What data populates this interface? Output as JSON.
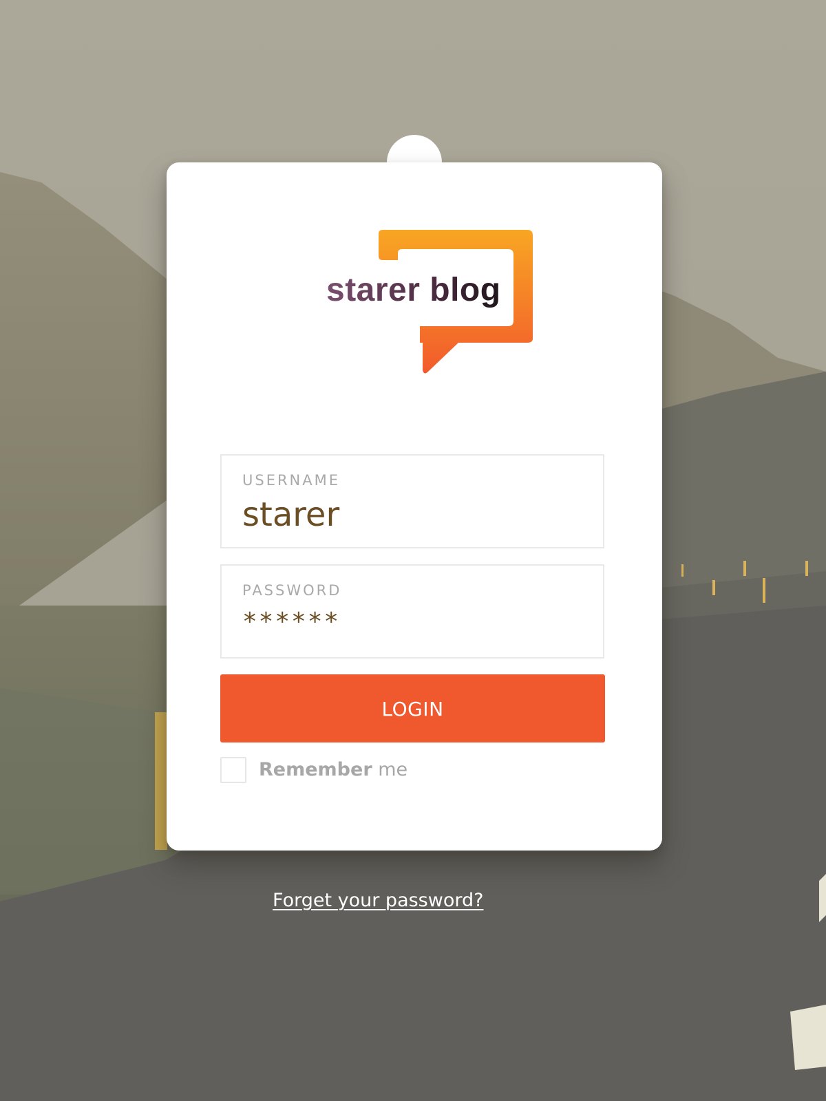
{
  "background": {
    "description_free": "",
    "scene_colors": {
      "sky": "#aaa69a",
      "hills": "#8a8675",
      "road": "#5f5e5a",
      "markings": "#e8e4d4",
      "posts": "#d7b04a"
    }
  },
  "logo": {
    "text": "starer blog",
    "colors": {
      "bubble_top": "#f8a623",
      "bubble_bottom": "#f25a2c",
      "text_start": "#7a4f6f",
      "text_end": "#1b1418"
    }
  },
  "form": {
    "username": {
      "label": "USERNAME",
      "value": "starer"
    },
    "password": {
      "label": "PASSWORD",
      "value": "******"
    },
    "login_label": "LOGIN",
    "remember": {
      "label_bold": "Remember",
      "label_light": "me",
      "checked": false
    },
    "accent_color": "#f0582e"
  },
  "forgot_password": "Forget your password?"
}
